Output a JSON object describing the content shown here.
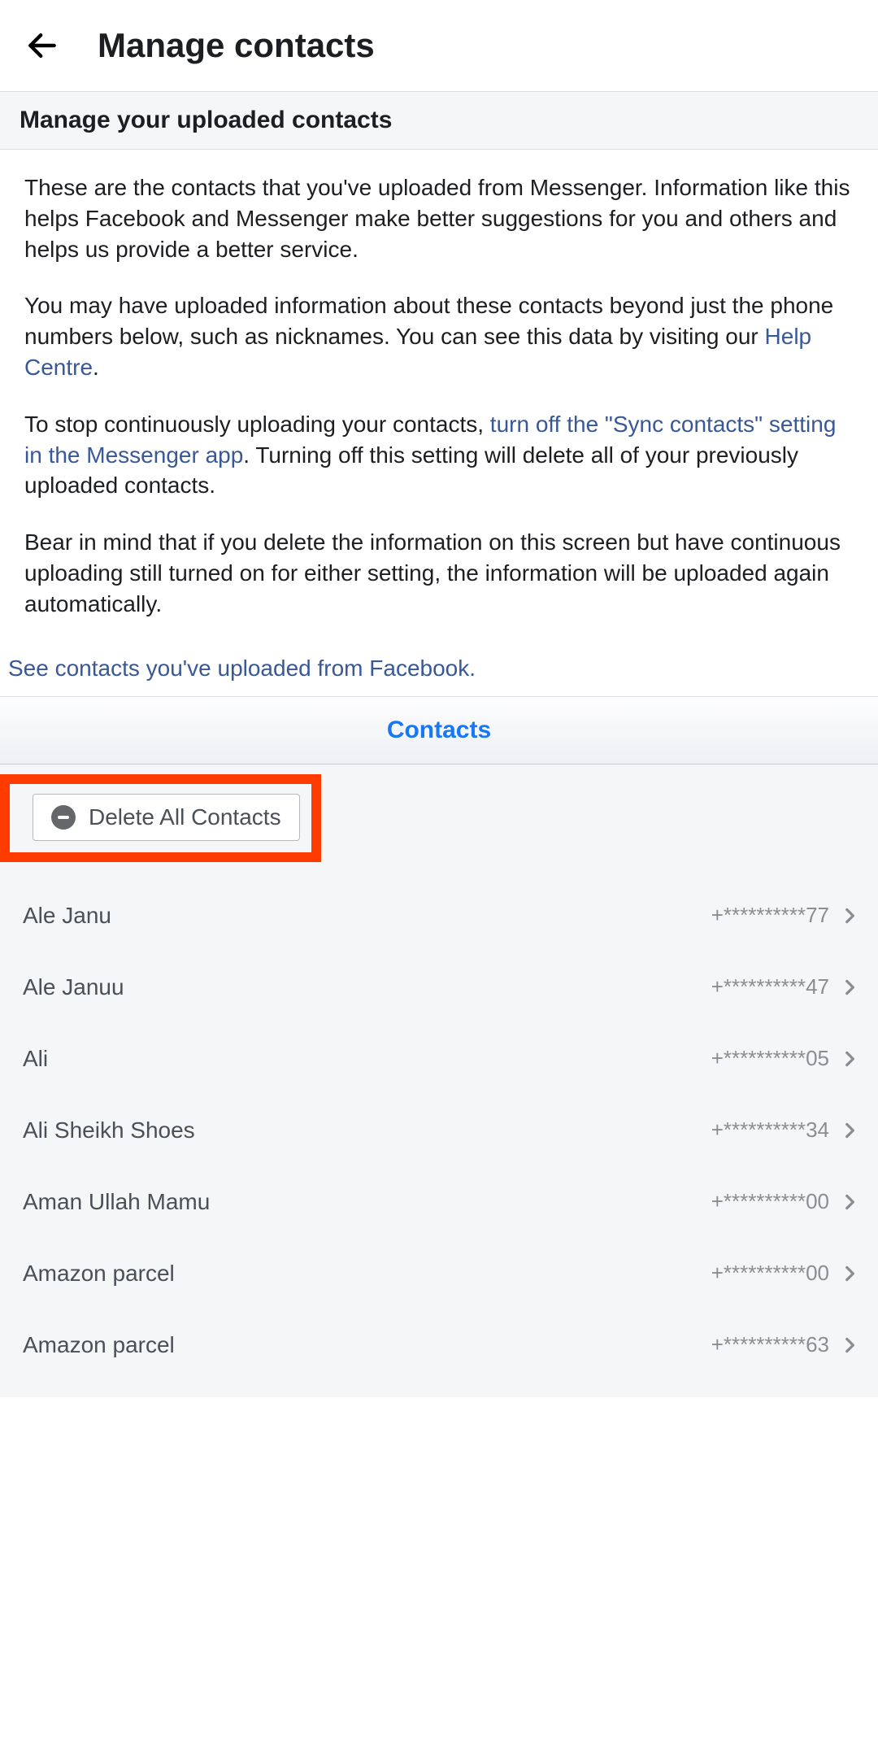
{
  "header": {
    "title": "Manage contacts"
  },
  "subheader": "Manage your uploaded contacts",
  "info": {
    "p1": "These are the contacts that you've uploaded from Messenger. Information like this helps Facebook and Messenger make better suggestions for you and others and helps us provide a better service.",
    "p2a": "You may have uploaded information about these contacts beyond just the phone numbers below, such as nicknames. You can see this data by visiting our ",
    "p2_link": "Help Centre",
    "p2b": ".",
    "p3a": "To stop continuously uploading your contacts, ",
    "p3_link": "turn off the \"Sync contacts\" setting in the Messenger app",
    "p3b": ". Turning off this setting will delete all of your previously uploaded contacts.",
    "p4": "Bear in mind that if you delete the information on this screen but have continuous uploading still turned on for either setting, the information will be uploaded again automatically."
  },
  "see_uploaded_link": "See contacts you've uploaded from Facebook.",
  "contacts_header": "Contacts",
  "delete_all_label": "Delete All Contacts",
  "contacts": [
    {
      "name": "Ale Janu",
      "phone": "+**********77"
    },
    {
      "name": "Ale Januu",
      "phone": "+**********47"
    },
    {
      "name": "Ali",
      "phone": "+**********05"
    },
    {
      "name": "Ali Sheikh Shoes",
      "phone": "+**********34"
    },
    {
      "name": "Aman Ullah Mamu",
      "phone": "+**********00"
    },
    {
      "name": "Amazon parcel",
      "phone": "+**********00"
    },
    {
      "name": "Amazon parcel",
      "phone": "+**********63"
    }
  ]
}
